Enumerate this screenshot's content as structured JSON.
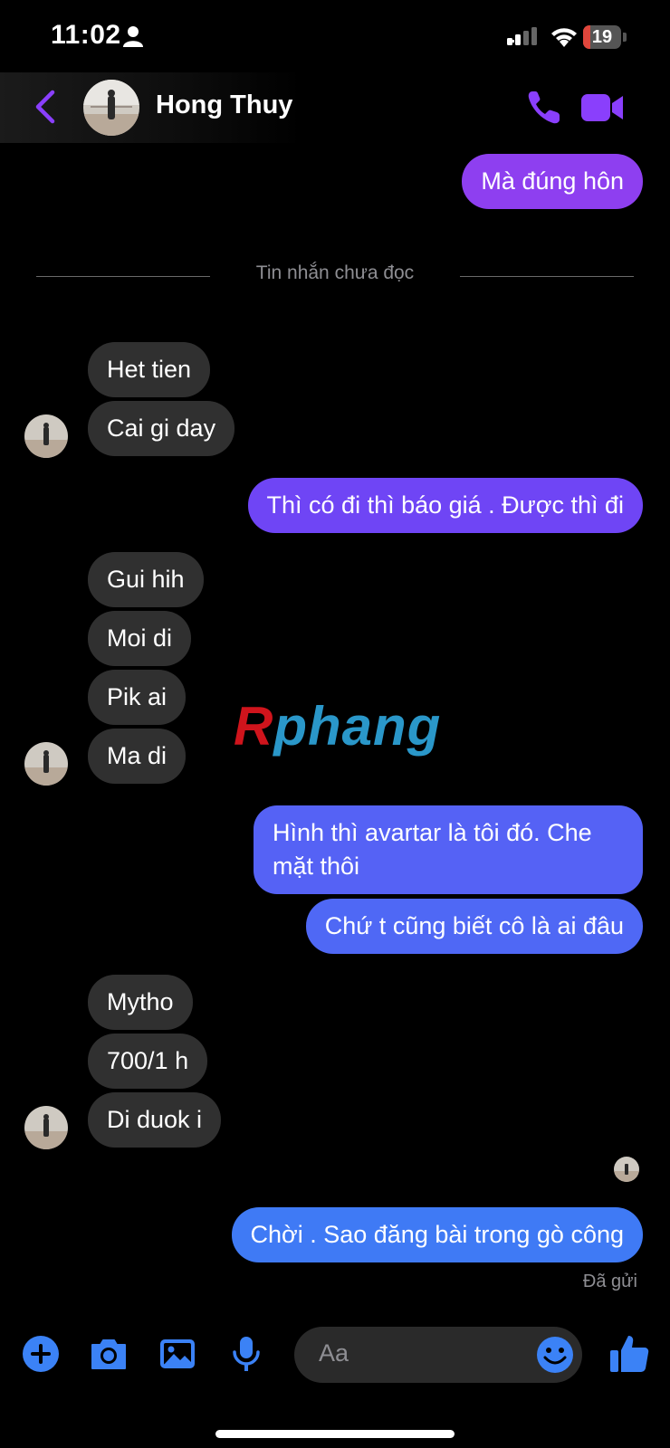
{
  "status_bar": {
    "time": "11:02",
    "battery_level": "19",
    "battery_color": "#e0463c"
  },
  "header": {
    "contact_name": "Hong Thuy",
    "back_icon": "chevron-left-icon",
    "call_icon": "phone-icon",
    "video_icon": "video-camera-icon",
    "accent_color": "#8a3ffc"
  },
  "divider": {
    "label": "Tin nhắn chưa đọc"
  },
  "messages": {
    "m1": "Mà đúng hôn",
    "m2": "Het tien",
    "m3": "Cai gi day",
    "m4": "Thì có đi thì báo giá . Được thì đi",
    "m5": "Gui hih",
    "m6": "Moi di",
    "m7": "Pik ai",
    "m8": "Ma di",
    "m9": "Hình thì avartar là tôi đó. Che",
    "m9b": "mặt thôi",
    "m10": "Chứ t cũng biết cô là ai đâu",
    "m11": "Mytho",
    "m12": "700/1 h",
    "m13": "Di duok i",
    "m14": "Chời . Sao đăng bài trong gò công"
  },
  "delivery_status": "Đã gửi",
  "watermark": {
    "first": "R",
    "rest": "phang"
  },
  "composer": {
    "placeholder": "Aa",
    "icons": [
      "plus-circle-icon",
      "camera-icon",
      "image-icon",
      "microphone-icon",
      "emoji-icon",
      "thumbs-up-icon"
    ],
    "icon_color": "#3b82f6"
  }
}
